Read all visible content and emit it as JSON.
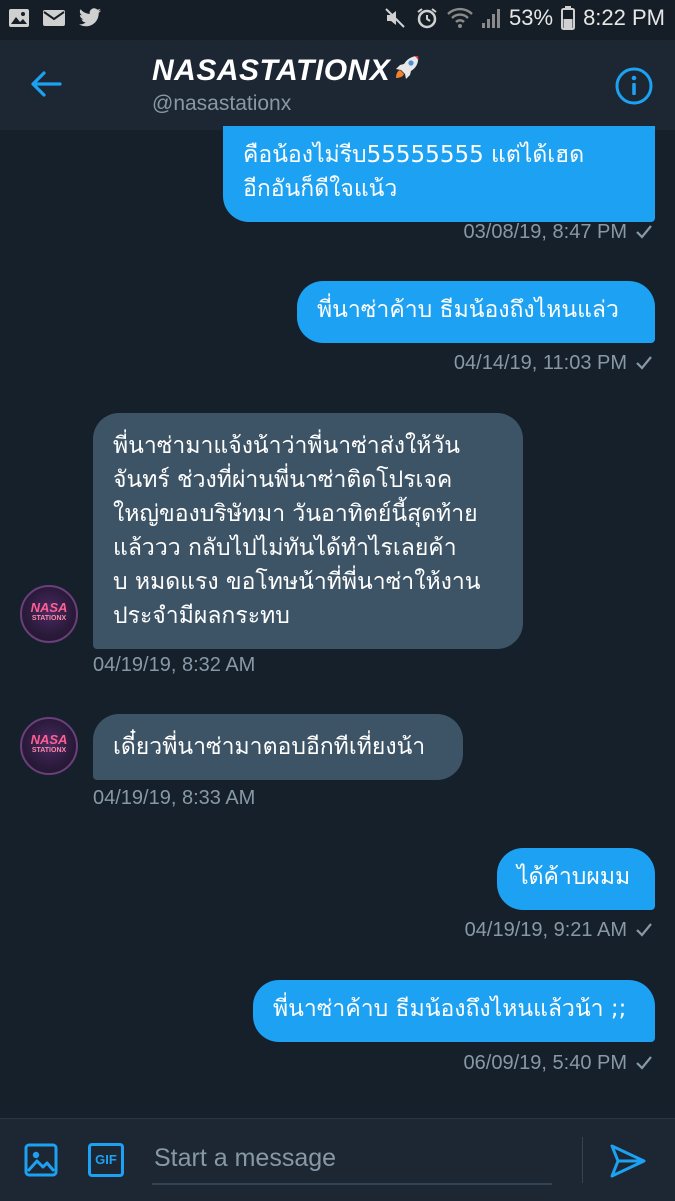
{
  "status_bar": {
    "battery": "53%",
    "time": "8:22 PM"
  },
  "header": {
    "display_name": "NASASTATIONX",
    "name_emoji": "rocket",
    "handle": "@nasastationx",
    "back_icon": "arrow-left-icon",
    "info_icon": "info-icon"
  },
  "avatar": {
    "line1": "NASA",
    "line2": "STATIONX"
  },
  "messages": [
    {
      "type": "sent",
      "text": "คือน้องไม่รีบ55555555 แต่ได้เฮด\nอีกอันก็ดีใจแน้ว",
      "time": "03/08/19, 8:47 PM"
    },
    {
      "type": "sent",
      "text": "พี่นาซ่าค้าบ ธีมน้องถึงไหนแล่ว",
      "time": "04/14/19, 11:03 PM"
    },
    {
      "type": "received",
      "text": "พี่นาซ่ามาแจ้งน้าว่าพี่นาซ่าส่งให้วัน\nจันทร์ ช่วงที่ผ่านพี่นาซ่าติดโปรเจค\nใหญ่ของบริษัทมา วันอาทิตย์นี้สุดท้าย\nแล้ววว กลับไปไม่ทันได้ทำไรเลยค้า\nบ หมดแรง ขอโทษน้าที่พี่นาซ่าให้งาน\nประจำมีผลกระทบ",
      "time": "04/19/19, 8:32 AM"
    },
    {
      "type": "received",
      "text": "เดี๋ยวพี่นาซ่ามาตอบอีกทีเที่ยงน้า",
      "time": "04/19/19, 8:33 AM"
    },
    {
      "type": "sent",
      "text": "ได้ค้าบผมม",
      "time": "04/19/19, 9:21 AM"
    },
    {
      "type": "sent",
      "text": "พี่นาซ่าค้าบ ธีมน้องถึงไหนแล้วน้า ;;",
      "time": "06/09/19, 5:40 PM"
    }
  ],
  "composer": {
    "placeholder": "Start a message",
    "image_icon": "image-icon",
    "gif_label": "GIF",
    "send_icon": "send-icon"
  },
  "colors": {
    "background": "#15202b",
    "header": "#1c2733",
    "sent_bubble": "#1da1f2",
    "received_bubble": "#3d5466",
    "muted_text": "#8899a6"
  }
}
